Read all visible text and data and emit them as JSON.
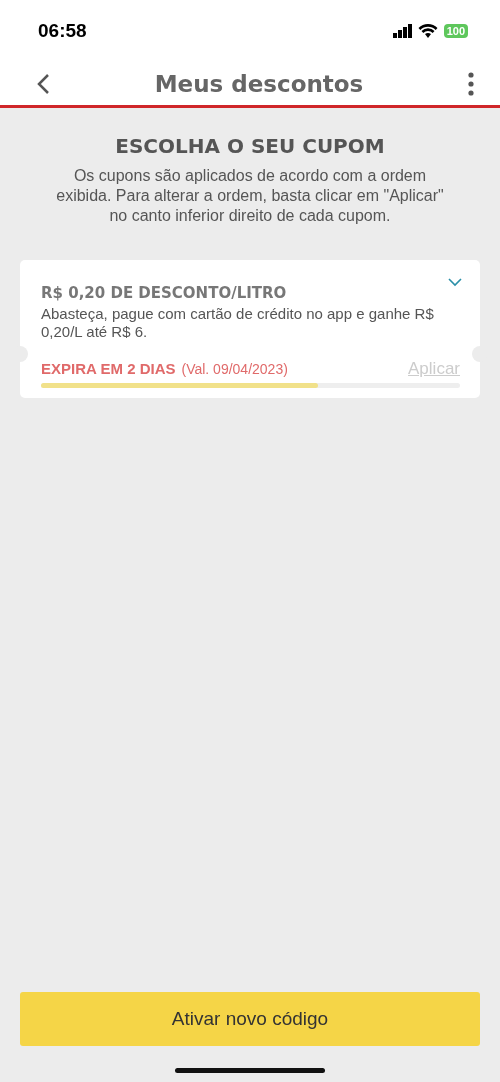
{
  "status_bar": {
    "time": "06:58",
    "battery": "100"
  },
  "header": {
    "title": "Meus descontos"
  },
  "intro": {
    "heading": "ESCOLHA O SEU CUPOM",
    "text": "Os cupons são aplicados de acordo com a ordem exibida. Para alterar a ordem, basta clicar em \"Aplicar\" no canto inferior direito de cada cupom."
  },
  "coupons": [
    {
      "title": "R$ 0,20 DE DESCONTO/LITRO",
      "description": "Abasteça, pague com cartão de crédito no app e ganhe R$ 0,20/L até R$ 6.",
      "expires": "EXPIRA EM 2 DIAS",
      "validity": "(Val. 09/04/2023)",
      "apply_label": "Aplicar",
      "disabled": true,
      "expanded": false,
      "level": 0.66
    }
  ],
  "primary_button": "Ativar novo código"
}
